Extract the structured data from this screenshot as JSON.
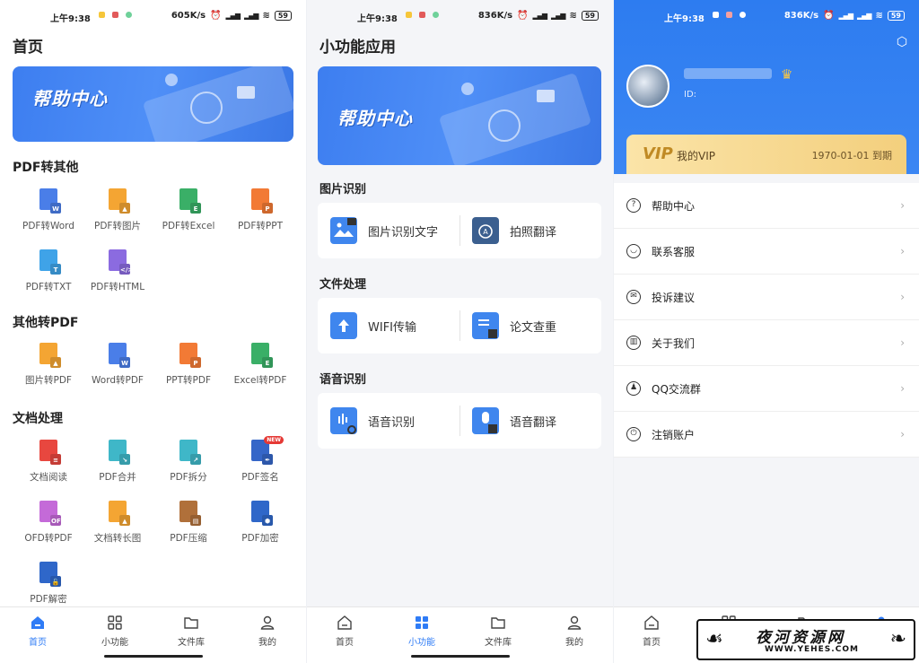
{
  "status": {
    "time": "上午9:38",
    "speed1": "605K/s",
    "speed2": "836K/s",
    "speed3": "836K/s",
    "battery": "59"
  },
  "home": {
    "title": "首页",
    "banner_text": "帮助中心",
    "sections": [
      {
        "title": "PDF转其他",
        "items": [
          {
            "label": "PDF转Word",
            "color": "#4a7ee8",
            "glyph": "W"
          },
          {
            "label": "PDF转图片",
            "color": "#f4a533",
            "glyph": "▲"
          },
          {
            "label": "PDF转Excel",
            "color": "#3aaf67",
            "glyph": "E"
          },
          {
            "label": "PDF转PPT",
            "color": "#f27a35",
            "glyph": "P"
          },
          {
            "label": "PDF转TXT",
            "color": "#3fa3e8",
            "glyph": "T"
          },
          {
            "label": "PDF转HTML",
            "color": "#8b6be0",
            "glyph": "</>"
          }
        ]
      },
      {
        "title": "其他转PDF",
        "items": [
          {
            "label": "图片转PDF",
            "color": "#f4a533",
            "glyph": "▲"
          },
          {
            "label": "Word转PDF",
            "color": "#4a7ee8",
            "glyph": "W"
          },
          {
            "label": "PPT转PDF",
            "color": "#f27a35",
            "glyph": "P"
          },
          {
            "label": "Excel转PDF",
            "color": "#3aaf67",
            "glyph": "E"
          }
        ]
      },
      {
        "title": "文档处理",
        "items": [
          {
            "label": "文档阅读",
            "color": "#e8473f",
            "glyph": "≡"
          },
          {
            "label": "PDF合并",
            "color": "#3fb7c8",
            "glyph": "↘"
          },
          {
            "label": "PDF拆分",
            "color": "#3fb7c8",
            "glyph": "↗"
          },
          {
            "label": "PDF签名",
            "color": "#3566c8",
            "glyph": "✒",
            "badge": "NEW"
          },
          {
            "label": "OFD转PDF",
            "color": "#c46ad8",
            "glyph": "OFD"
          },
          {
            "label": "文档转长图",
            "color": "#f4a533",
            "glyph": "▲"
          },
          {
            "label": "PDF压缩",
            "color": "#b0703a",
            "glyph": "▤"
          },
          {
            "label": "PDF加密",
            "color": "#2f67c9",
            "glyph": "⬢"
          },
          {
            "label": "PDF解密",
            "color": "#2f67c9",
            "glyph": "🔓"
          }
        ]
      }
    ]
  },
  "tools": {
    "title": "小功能应用",
    "banner_text": "帮助中心",
    "groups": [
      {
        "title": "图片识别",
        "items": [
          {
            "label": "图片识别文字",
            "color": "#3f86ee"
          },
          {
            "label": "拍照翻译",
            "color": "#3b5f8f"
          }
        ]
      },
      {
        "title": "文件处理",
        "items": [
          {
            "label": "WIFI传输",
            "color": "#3f86ee"
          },
          {
            "label": "论文查重",
            "color": "#3f86ee"
          }
        ]
      },
      {
        "title": "语音识别",
        "items": [
          {
            "label": "语音识别",
            "color": "#3f86ee"
          },
          {
            "label": "语音翻译",
            "color": "#3f86ee"
          }
        ]
      }
    ]
  },
  "profile": {
    "uid_label": "ID:",
    "vip_logo": "VIP",
    "vip_title": "我的VIP",
    "vip_expire": "1970-01-01 到期",
    "menu": [
      {
        "label": "帮助中心",
        "icon": "?"
      },
      {
        "label": "联系客服",
        "icon": "◡"
      },
      {
        "label": "投诉建议",
        "icon": "✉"
      },
      {
        "label": "关于我们",
        "icon": "▥"
      },
      {
        "label": "QQ交流群",
        "icon": "♟"
      },
      {
        "label": "注销账户",
        "icon": "⏻"
      }
    ]
  },
  "nav": {
    "items": [
      "首页",
      "小功能",
      "文件库",
      "我的"
    ]
  },
  "watermark": {
    "title": "夜河资源网",
    "url": "WWW.YEHES.COM"
  }
}
